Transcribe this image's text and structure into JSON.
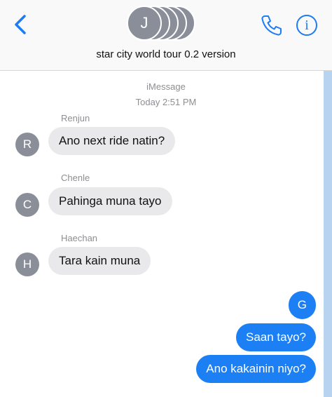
{
  "header": {
    "avatar_initial": "J",
    "group_name": "star city world tour 0.2 version",
    "info_symbol": "i"
  },
  "thread": {
    "service": "iMessage",
    "timestamp": "Today 2:51 PM"
  },
  "messages": [
    {
      "sender": "Renjun",
      "initial": "R",
      "text": "Ano next ride natin?"
    },
    {
      "sender": "Chenle",
      "initial": "C",
      "text": "Pahinga muna tayo"
    },
    {
      "sender": "Haechan",
      "initial": "H",
      "text": "Tara kain muna"
    },
    {
      "initial": "G",
      "text": "G"
    },
    {
      "text": "Saan tayo?"
    },
    {
      "text": "Ano kakainin niyo?"
    }
  ],
  "colors": {
    "accent": "#1d7cf2",
    "outgoing_bubble": "#1c7ff4",
    "incoming_bubble": "#e9e9eb",
    "avatar": "#8a8e99"
  },
  "icons": [
    "back-chevron-icon",
    "phone-icon",
    "info-icon"
  ]
}
